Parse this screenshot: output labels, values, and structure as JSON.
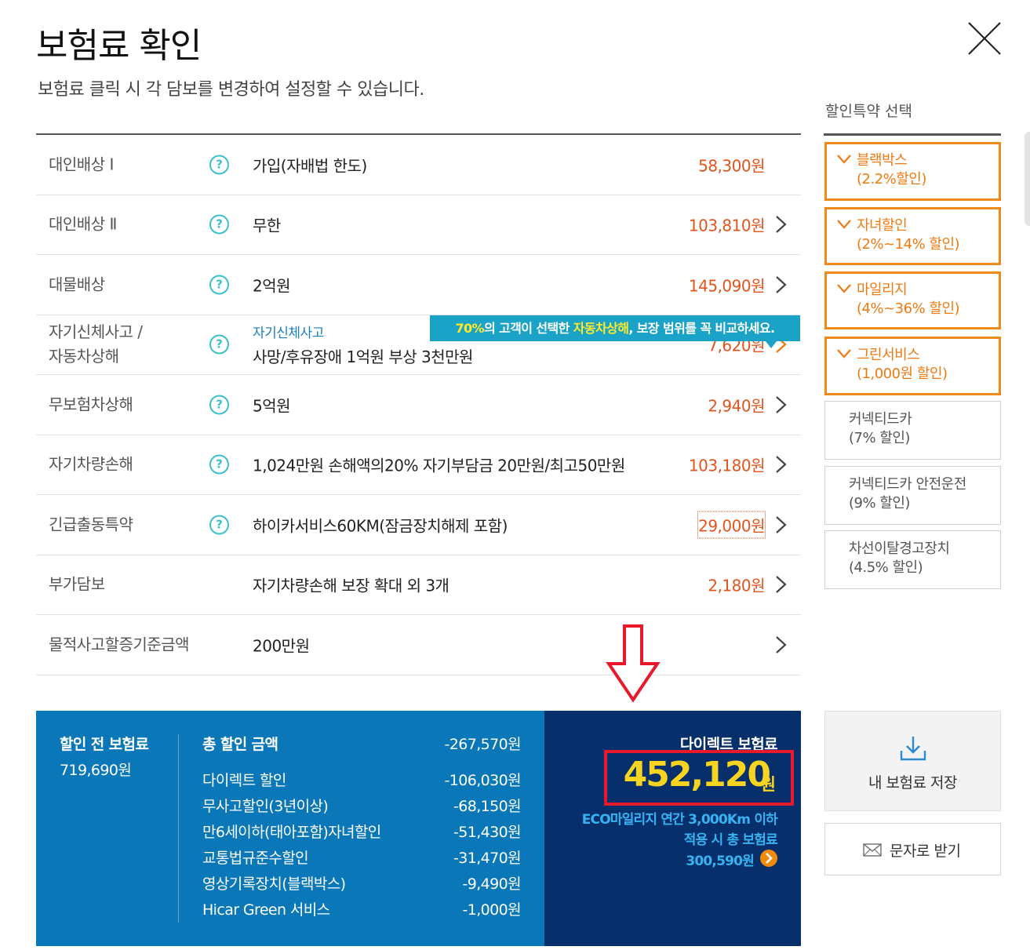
{
  "header": {
    "title": "보험료 확인",
    "subtitle": "보험료 클릭 시 각 담보를 변경하여 설정할 수 있습니다."
  },
  "coverages": [
    {
      "label": "대인배상 Ⅰ",
      "value": "가입(자배법 한도)",
      "price": "58,300원"
    },
    {
      "label": "대인배상 Ⅱ",
      "value": "무한",
      "price": "103,810원"
    },
    {
      "label": "대물배상",
      "value": "2억원",
      "price": "145,090원"
    },
    {
      "label1": "자기신체사고 /",
      "label2": "자동차상해",
      "sub": "자기신체사고",
      "value": "사망/후유장애 1억원 부상 3천만원",
      "price": "7,620원"
    },
    {
      "label": "무보험차상해",
      "value": "5억원",
      "price": "2,940원"
    },
    {
      "label": "자기차량손해",
      "value": "1,024만원 손해액의20% 자기부담금 20만원/최고50만원",
      "price": "103,180원"
    },
    {
      "label": "긴급출동특약",
      "value": "하이카서비스60KM(잠금장치해제 포함)",
      "price": "29,000원"
    },
    {
      "label": "부가담보",
      "value": "자기차량손해 보장 확대 외 3개",
      "price": "2,180원"
    },
    {
      "label": "물적사고할증기준금액",
      "value": "200만원",
      "price": ""
    }
  ],
  "help_glyph": "?",
  "tooltip": {
    "part1": "70%",
    "part2": "의 고객이 선택한 ",
    "part3": "자동차상해",
    "part4": ", 보장 범위를 꼭 비교하세요."
  },
  "sidebar": {
    "title": "할인특약 선택",
    "options": [
      {
        "name": "블랙박스",
        "detail": "(2.2%할인)",
        "selected": true
      },
      {
        "name": "자녀할인",
        "detail": "(2%~14% 할인)",
        "selected": true
      },
      {
        "name": "마일리지",
        "detail": "(4%~36% 할인)",
        "selected": true
      },
      {
        "name": "그린서비스",
        "detail": "(1,000원 할인)",
        "selected": true
      },
      {
        "name": "커넥티드카",
        "detail": "(7% 할인)",
        "selected": false
      },
      {
        "name": "커넥티드카 안전운전",
        "detail": "(9% 할인)",
        "selected": false
      },
      {
        "name": "차선이탈경고장치",
        "detail": "(4.5% 할인)",
        "selected": false
      }
    ],
    "save_label": "내 보험료 저장",
    "sms_label": "문자로 받기"
  },
  "summary": {
    "pre_label": "할인 전 보험료",
    "pre_value": "719,690원",
    "discount_title": "총 할인 금액",
    "discount_total": "-267,570원",
    "discounts": [
      {
        "name": "다이렉트 할인",
        "amount": "-106,030원"
      },
      {
        "name": "무사고할인(3년이상)",
        "amount": "-68,150원"
      },
      {
        "name": "만6세이하(태아포함)자녀할인",
        "amount": "-51,430원"
      },
      {
        "name": "교통법규준수할인",
        "amount": "-31,470원"
      },
      {
        "name": "영상기록장치(블랙박스)",
        "amount": "-9,490원"
      },
      {
        "name": "Hicar Green 서비스",
        "amount": "-1,000원"
      }
    ],
    "direct_label": "다이렉트 보험료",
    "direct_price": "452,120",
    "direct_unit": "원",
    "eco_line1": "ECO마일리지 연간 3,000Km 이하",
    "eco_line2": "적용 시 총 보험료",
    "eco_price": "300,590원"
  },
  "colors": {
    "accent_orange": "#ef8a1a",
    "price_red": "#e2541c",
    "panel_blue": "#0a78b8",
    "panel_navy": "#062f6b",
    "highlight_yellow": "#f6d420",
    "annotation_red": "#e8192b"
  }
}
